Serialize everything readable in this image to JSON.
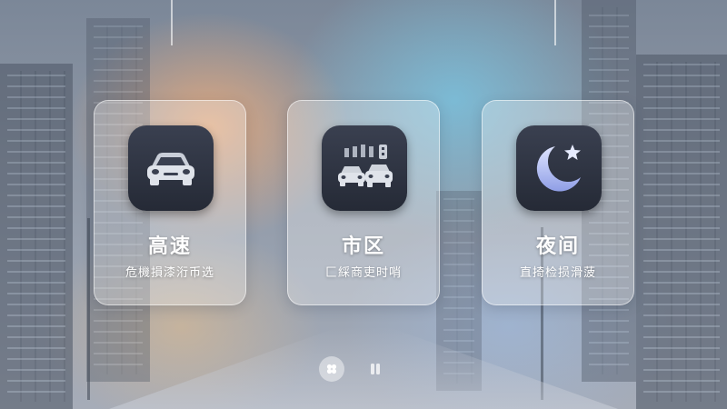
{
  "modes": [
    {
      "title": "高速",
      "subtitle": "危機損漆洐币选",
      "icon": "car-icon"
    },
    {
      "title": "市区",
      "subtitle": "匚綵商吏时哨",
      "icon": "city-traffic-icon"
    },
    {
      "title": "夜间",
      "subtitle": "直掎检损滑菠",
      "icon": "moon-star-icon"
    }
  ],
  "pager": {
    "active_icon": "flower-icon",
    "other_icon": "pause-icon"
  },
  "colors": {
    "tile_dark": "#2b303c",
    "moon": "#b8c3f0",
    "card_glass": "rgba(255,255,255,0.30)"
  }
}
